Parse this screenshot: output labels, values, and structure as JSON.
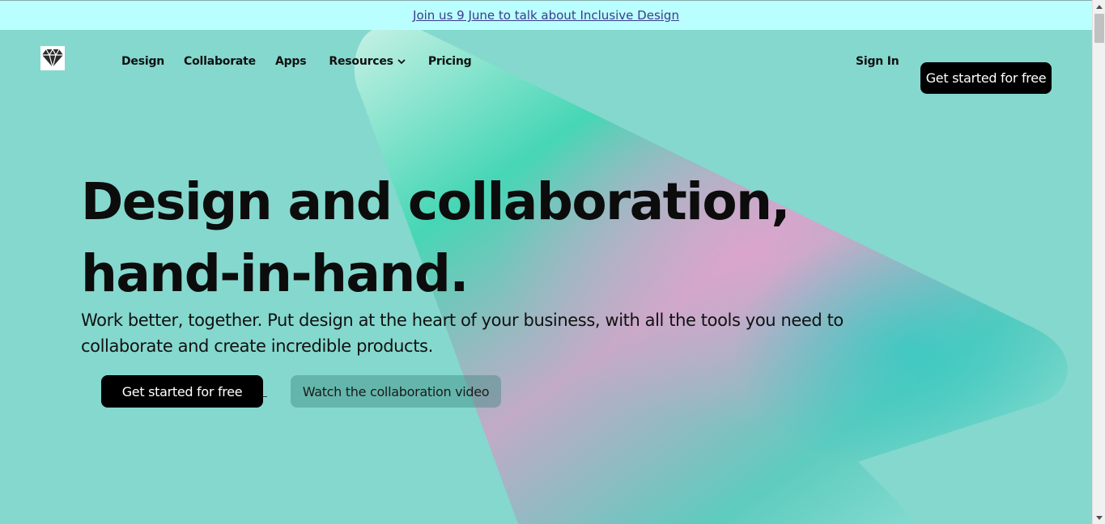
{
  "announcement": {
    "text": "Join us 9 June to talk about Inclusive Design"
  },
  "brand": {
    "logo_icon": "diamond-icon"
  },
  "nav": {
    "items": [
      {
        "label": "Design"
      },
      {
        "label": "Collaborate"
      },
      {
        "label": "Apps"
      },
      {
        "label": "Resources",
        "has_dropdown": true
      },
      {
        "label": "Pricing"
      }
    ]
  },
  "header": {
    "signin_label": "Sign In",
    "cta_label": "Get started for free"
  },
  "hero": {
    "headline_line1": "Design and collaboration,",
    "headline_line2": "hand-in-hand.",
    "subhead": "Work better, together. Put design at the heart of your business, with all the tools you need to collaborate and create incredible products.",
    "primary_button": "Get started for free",
    "secondary_button": "Watch the collaboration video"
  },
  "colors": {
    "background": "#85d8ce",
    "announcement_bg": "#baffff",
    "button_dark": "#000000",
    "accent_pink": "#d9a6c8",
    "accent_teal": "#3fd4b5"
  }
}
